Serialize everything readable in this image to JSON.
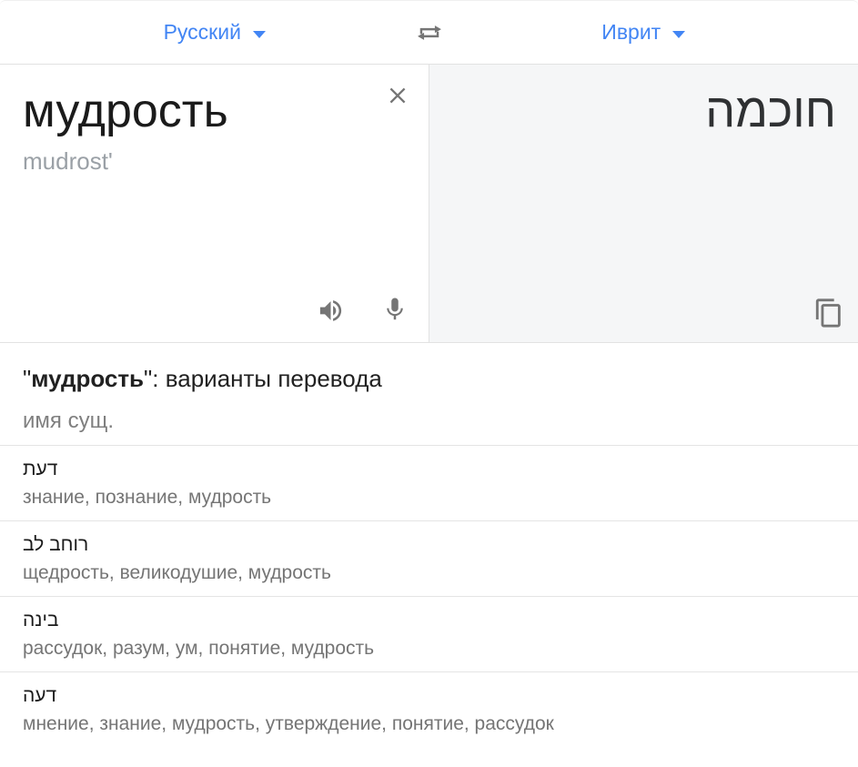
{
  "colors": {
    "accent_blue": "#4285f4",
    "panel_gray_bg": "#f5f6f7",
    "divider": "#e4e4e4",
    "text_primary": "#212121",
    "text_secondary": "#757575",
    "transliteration_gray": "#9aa0a6",
    "icon_gray": "#757575"
  },
  "icons": {
    "dropdown": "chevron-down ▾ css-triangle",
    "swap": "swap-horizontal-arrows ⇄",
    "close": "close ✕",
    "speaker": "volume-up 🔊",
    "microphone": "mic 🎤",
    "copy": "content-copy ⧉"
  },
  "header": {
    "source_language": "Русский",
    "target_language": "Иврит"
  },
  "source_panel": {
    "text": "мудрость",
    "transliteration": "mudrost'"
  },
  "target_panel": {
    "text": "חוכמה"
  },
  "variants": {
    "title_quote_open": "\"",
    "title_term": "мудрость",
    "title_rest": "\": варианты перевода",
    "part_of_speech": "имя сущ.",
    "rows": [
      {
        "term": "דעת",
        "translations": "знание, познание, мудрость"
      },
      {
        "term": "רוחב לב",
        "translations": "щедрость, великодушие, мудрость"
      },
      {
        "term": "בינה",
        "translations": "рассудок, разум, ум, понятие, мудрость"
      },
      {
        "term": "דעה",
        "translations": "мнение, знание, мудрость, утверждение, понятие, рассудок"
      }
    ]
  }
}
